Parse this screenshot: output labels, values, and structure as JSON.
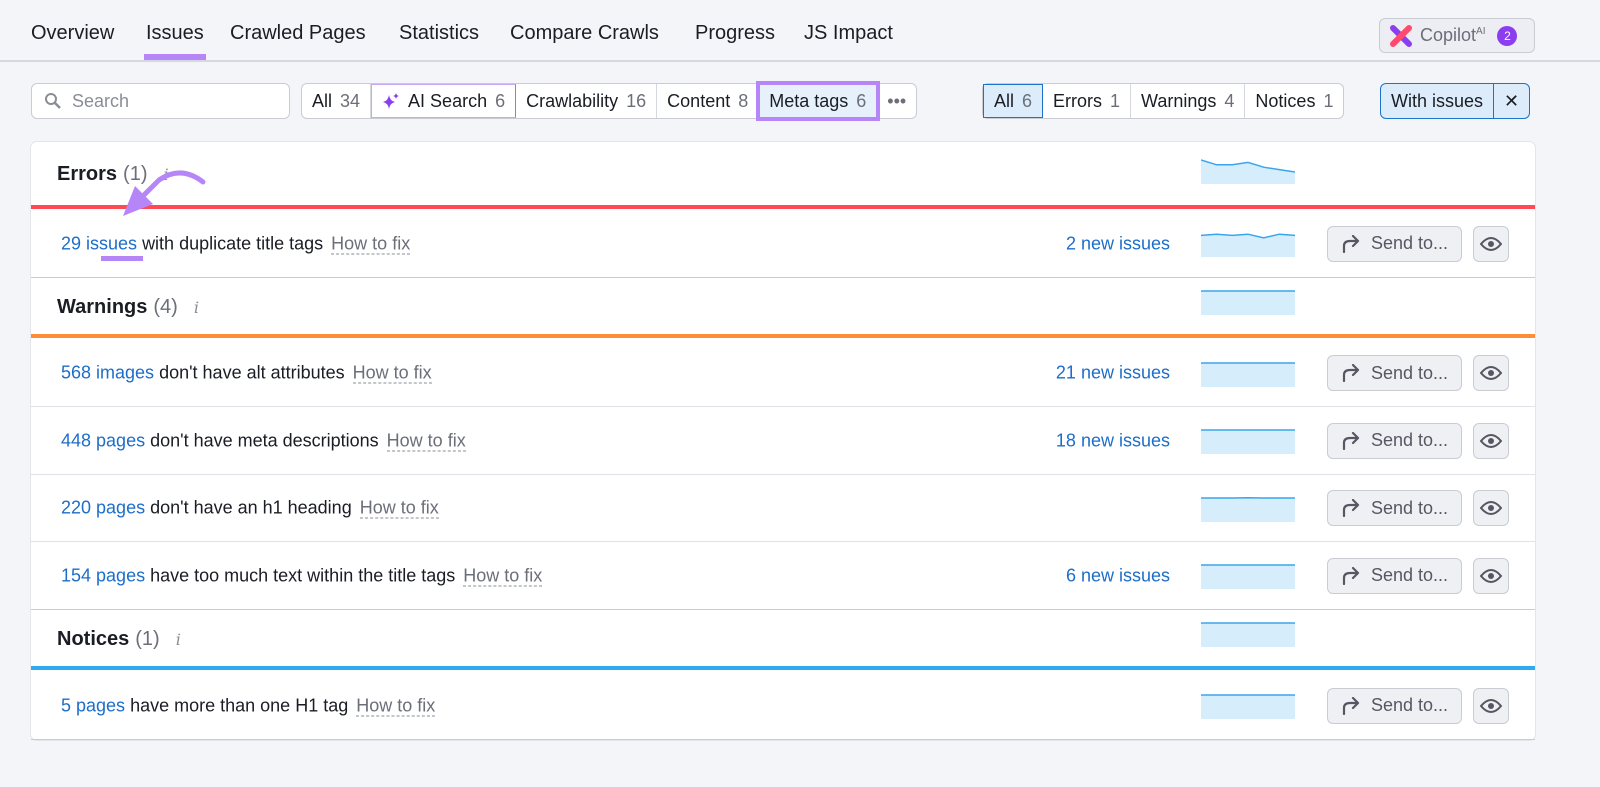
{
  "nav": {
    "tabs": [
      "Overview",
      "Issues",
      "Crawled Pages",
      "Statistics",
      "Compare Crawls",
      "Progress",
      "JS Impact"
    ],
    "active": "Issues"
  },
  "copilot": {
    "label": "Copilot",
    "sup": "AI",
    "badge": "2"
  },
  "search": {
    "placeholder": "Search"
  },
  "categories": [
    {
      "label": "All",
      "count": "34"
    },
    {
      "label": "AI Search",
      "count": "6"
    },
    {
      "label": "Crawlability",
      "count": "16"
    },
    {
      "label": "Content",
      "count": "8"
    },
    {
      "label": "Meta tags",
      "count": "6",
      "selected": true
    }
  ],
  "more_label": "•••",
  "severity": [
    {
      "label": "All",
      "count": "6",
      "selected": true
    },
    {
      "label": "Errors",
      "count": "1"
    },
    {
      "label": "Warnings",
      "count": "4"
    },
    {
      "label": "Notices",
      "count": "1"
    }
  ],
  "filter": {
    "label": "With issues",
    "close": "✕"
  },
  "colors": {
    "error": "#ff4953",
    "warning": "#ff8c3a",
    "notice": "#2fa9ef",
    "link": "#1d6ec9",
    "accent": "#b685f7"
  },
  "sections": {
    "errors": {
      "title": "Errors",
      "count": "(1)",
      "trend": [
        10,
        8,
        8,
        9,
        7,
        6,
        5
      ]
    },
    "warnings": {
      "title": "Warnings",
      "count": "(4)",
      "trend": [
        10,
        10,
        10,
        10,
        10,
        10,
        10
      ]
    },
    "notices": {
      "title": "Notices",
      "count": "(1)",
      "trend": [
        10,
        10,
        10,
        10,
        10,
        10,
        10
      ]
    }
  },
  "send_label": "Send to...",
  "how_to_fix": "How to fix",
  "issues": [
    {
      "link": "29 issues",
      "text": "with duplicate title tags",
      "new": "2 new issues",
      "trend": [
        9,
        9.5,
        9,
        9.5,
        8,
        9.5,
        9
      ]
    },
    {
      "link": "568 images",
      "text": "don't have alt attributes",
      "new": "21 new issues",
      "trend": [
        10,
        10,
        10,
        10,
        10,
        10,
        10
      ]
    },
    {
      "link": "448 pages",
      "text": "don't have meta descriptions",
      "new": "18 new issues",
      "trend": [
        10,
        10,
        10,
        10,
        10,
        10,
        10
      ]
    },
    {
      "link": "220 pages",
      "text": "don't have an h1 heading",
      "new": "",
      "trend": [
        10,
        10,
        10,
        10.1,
        10,
        10,
        10
      ]
    },
    {
      "link": "154 pages",
      "text": "have too much text within the title tags",
      "new": "6 new issues",
      "trend": [
        10,
        10,
        10,
        10,
        10,
        10,
        10
      ]
    },
    {
      "link": "5 pages",
      "text": "have more than one H1 tag",
      "new": "",
      "trend": [
        10,
        10,
        10,
        10,
        10,
        10,
        10
      ]
    }
  ]
}
